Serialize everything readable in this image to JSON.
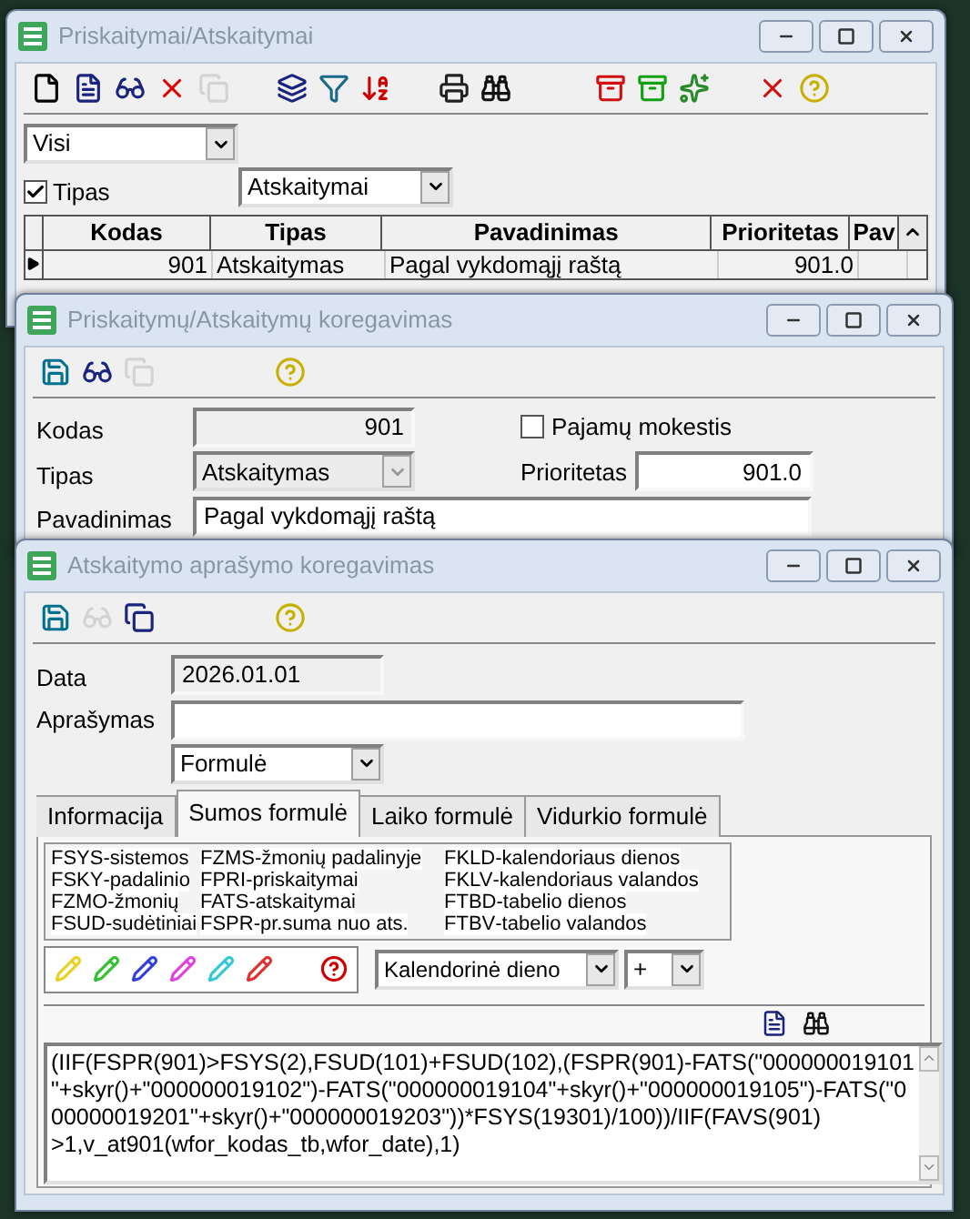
{
  "list_window": {
    "title": "Priskaitymai/Atskaitymai",
    "toolbar": [
      {
        "kind": "new",
        "disabled": false
      },
      {
        "kind": "doc",
        "disabled": false
      },
      {
        "kind": "glasses",
        "disabled": false
      },
      {
        "kind": "delete",
        "disabled": false
      },
      {
        "kind": "copy",
        "disabled": true
      },
      {
        "kind": "gap"
      },
      {
        "kind": "layers",
        "disabled": false
      },
      {
        "kind": "filter",
        "disabled": false
      },
      {
        "kind": "sort",
        "disabled": false
      },
      {
        "kind": "gap"
      },
      {
        "kind": "print",
        "disabled": false
      },
      {
        "kind": "find",
        "disabled": false
      },
      {
        "kind": "gap"
      },
      {
        "kind": "gap"
      },
      {
        "kind": "import",
        "disabled": false
      },
      {
        "kind": "export",
        "disabled": false
      },
      {
        "kind": "spark",
        "disabled": false
      },
      {
        "kind": "gap"
      },
      {
        "kind": "uncheck",
        "disabled": false
      },
      {
        "kind": "help",
        "disabled": false
      }
    ],
    "filter": {
      "value": "Visi"
    },
    "type_filter": {
      "label": "Tipas",
      "checked": true,
      "value": "Atskaitymai"
    },
    "table": {
      "columns": [
        "Kodas",
        "Tipas",
        "Pavadinimas",
        "Prioritetas",
        "Pav"
      ],
      "rows": [
        {
          "selected": true,
          "cells": [
            "901",
            "Atskaitymas",
            "Pagal vykdomąjį raštą",
            "901.0",
            ""
          ]
        }
      ]
    }
  },
  "edit_window": {
    "title": "Priskaitymų/Atskaitymų koregavimas",
    "toolbar": [
      {
        "kind": "save",
        "disabled": false
      },
      {
        "kind": "glasses",
        "disabled": false
      },
      {
        "kind": "copy",
        "disabled": true
      },
      {
        "kind": "gap"
      },
      {
        "kind": "gap"
      },
      {
        "kind": "gap"
      },
      {
        "kind": "help",
        "disabled": false
      }
    ],
    "code": {
      "label": "Kodas",
      "value": "901"
    },
    "type": {
      "label": "Tipas",
      "value": "Atskaitymas"
    },
    "income_tax": {
      "label": "Pajamų mokestis",
      "checked": false
    },
    "priority": {
      "label": "Prioritetas",
      "value": "901.0"
    },
    "name": {
      "label": "Pavadinimas",
      "value": "Pagal vykdomąjį raštą"
    }
  },
  "description_window": {
    "title": "Atskaitymo aprašymo koregavimas",
    "toolbar": [
      {
        "kind": "save",
        "disabled": false
      },
      {
        "kind": "glasses",
        "disabled": true
      },
      {
        "kind": "copy",
        "disabled": false
      },
      {
        "kind": "gap"
      },
      {
        "kind": "gap"
      },
      {
        "kind": "gap"
      },
      {
        "kind": "help",
        "disabled": false
      }
    ],
    "date": {
      "label": "Data",
      "value": "2026.01.01"
    },
    "description": {
      "label": "Aprašymas"
    },
    "mode": {
      "value": "Formulė"
    },
    "tabs": [
      {
        "label": "Informacija",
        "selected": false
      },
      {
        "label": "Sumos formulė",
        "selected": true
      },
      {
        "label": "Laiko formulė",
        "selected": false
      },
      {
        "label": "Vidurkio formulė",
        "selected": false
      }
    ],
    "legend": [
      [
        {
          "code": "FSYS",
          "text": "-sistemos"
        },
        {
          "code": "FSKY",
          "text": "-padalinio"
        },
        {
          "code": "FZMO",
          "text": "-žmonių"
        },
        {
          "code": "FSUD",
          "text": "-sudėtiniai"
        }
      ],
      [
        {
          "code": "FZMS",
          "text": "-žmonių padalinyje"
        },
        {
          "code": "FPRI",
          "text": "-priskaitymai"
        },
        {
          "code": "FATS",
          "text": "-atskaitymai"
        },
        {
          "code": "FSPR",
          "text": "-pr.suma nuo ats."
        }
      ],
      [
        {
          "code": "FKLD",
          "text": "-kalendoriaus dienos"
        },
        {
          "code": "FKLV",
          "text": "-kalendoriaus valandos"
        },
        {
          "code": "FTBD",
          "text": "-tabelio dienos"
        },
        {
          "code": "FTBV",
          "text": "-tabelio valandos"
        }
      ]
    ],
    "pencils": [
      {
        "color": "#e8d020"
      },
      {
        "color": "#30c030"
      },
      {
        "color": "#3040e0"
      },
      {
        "color": "#e040e0"
      },
      {
        "color": "#30c8d8"
      },
      {
        "color": "#e03030"
      }
    ],
    "unit": {
      "value": "Kalendorinė dieno"
    },
    "operator": {
      "value": "+"
    },
    "formula_lines": [
      "(IIF(FSPR(901)>FSYS(2),FSUD(101)+FSUD(102),(FSPR(901)-FATS(\"000000019101",
      "\"+skyr()+\"000000019102\")-FATS(\"000000019104\"+skyr()+\"000000019105\")-FATS(\"0",
      "00000019201\"+skyr()+\"000000019203\"))*FSYS(19301)/100))/IIF(FAVS(901)",
      ">1,v_at901(wfor_kodas_tb,wfor_date),1)"
    ]
  }
}
